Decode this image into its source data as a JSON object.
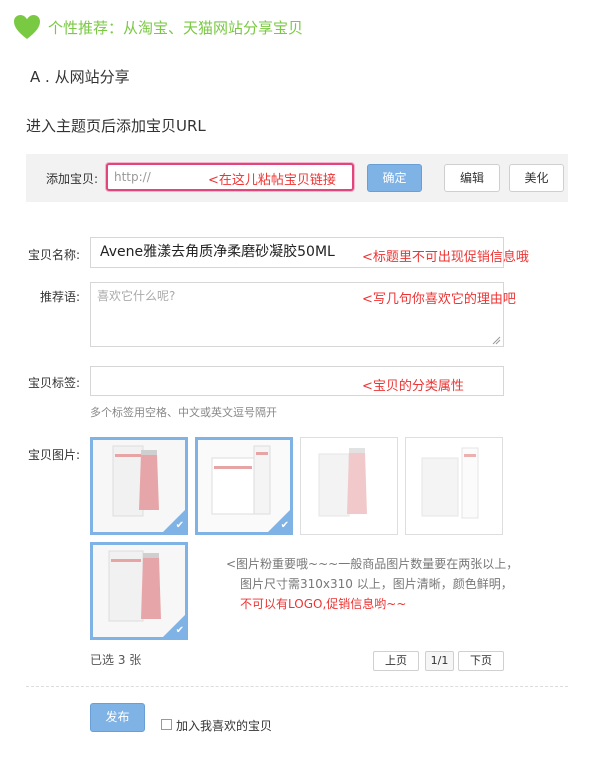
{
  "header": {
    "title": "个性推荐：从淘宝、天猫网站分享宝贝",
    "subtitle": "A . 从网站分享",
    "instruction": "进入主题页后添加宝贝URL"
  },
  "toolbar": {
    "label": "添加宝贝:",
    "url_placeholder": "http://",
    "url_annotation": "<在这儿粘帖宝贝链接",
    "confirm_label": "确定",
    "edit_label": "编辑",
    "beautify_label": "美化"
  },
  "form": {
    "name_label": "宝贝名称:",
    "name_value": "Avene雅漾去角质净柔磨砂凝胶50ML",
    "name_annotation": "<标题里不可出现促销信息哦",
    "reason_label": "推荐语:",
    "reason_placeholder": "喜欢它什么呢?",
    "reason_annotation": "<写几句你喜欢它的理由吧",
    "tags_label": "宝贝标签:",
    "tags_annotation": "<宝贝的分类属性",
    "tags_hint": "多个标签用空格、中文或英文逗号隔开",
    "images_label": "宝贝图片:"
  },
  "images": {
    "note_line1": "<图片粉重要哦~~~一般商品图片数量要在两张以上，",
    "note_line2": "图片尺寸需310x310 以上，图片清晰，颜色鲜明，",
    "note_line3": "不可以有LOGO,促销信息哟~~",
    "thumbnails": [
      {
        "selected": true
      },
      {
        "selected": true
      },
      {
        "selected": false
      },
      {
        "selected": false
      },
      {
        "selected": true
      }
    ],
    "selected_count": "已选 3 张",
    "prev": "上页",
    "page": "1/1",
    "next": "下页"
  },
  "footer": {
    "publish": "发布",
    "favorite_label": "加入我喜欢的宝贝",
    "favorite_checked": false
  },
  "colors": {
    "accent_green": "#7ac943",
    "annotation_red": "#e33333",
    "button_blue": "#7fb2e5",
    "highlight_pink": "#e0457b"
  }
}
